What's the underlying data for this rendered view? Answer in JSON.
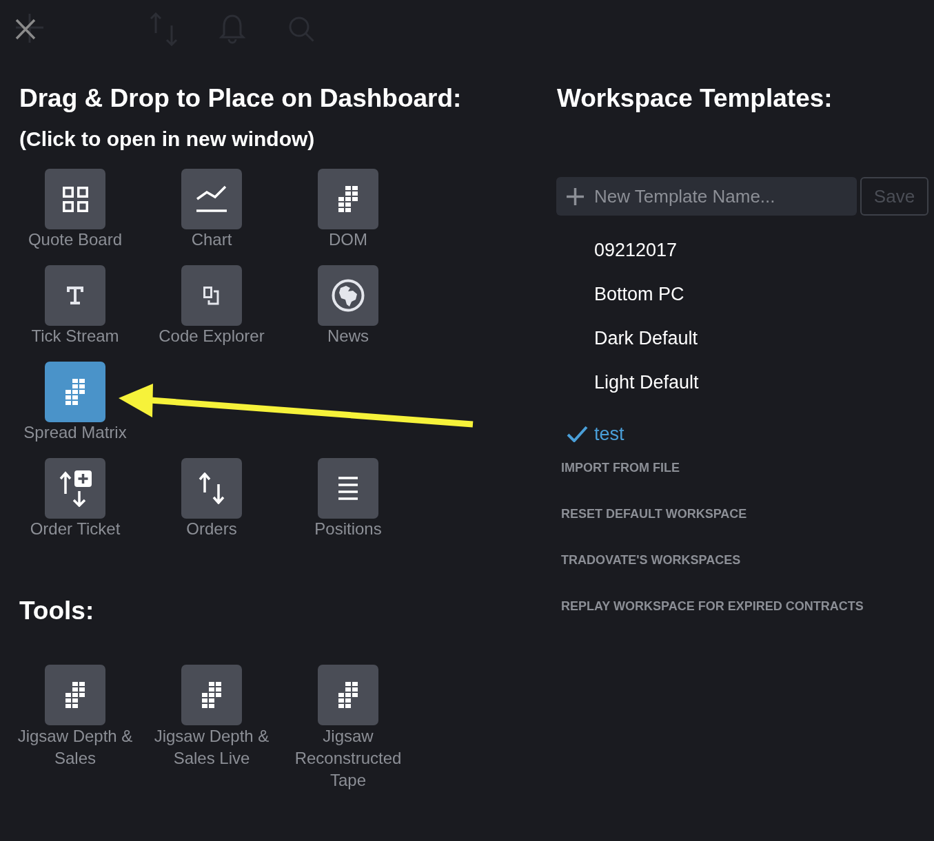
{
  "toolbar": {
    "buttons": [
      {
        "kind": "add",
        "disabled": true
      },
      {
        "kind": "close",
        "disabled": false
      },
      {
        "kind": "transfer",
        "disabled": true
      },
      {
        "kind": "notifications",
        "disabled": true
      },
      {
        "kind": "search",
        "disabled": true
      }
    ]
  },
  "widgets": {
    "title": "Drag & Drop to Place on Dashboard:",
    "subtitle": "(Click to open in new window)",
    "rows": [
      {
        "items": [
          {
            "label": "Quote Board",
            "kind": "quote_board",
            "selected": false
          },
          {
            "label": "Chart",
            "kind": "chart",
            "selected": false
          },
          {
            "label": "DOM",
            "kind": "depth",
            "selected": false
          }
        ]
      },
      {
        "items": [
          {
            "label": "Tick Stream",
            "kind": "tick_stream",
            "selected": false
          },
          {
            "label": "Code Explorer",
            "kind": "code_explorer",
            "selected": false
          },
          {
            "label": "News",
            "kind": "news",
            "selected": false
          }
        ]
      },
      {
        "items": [
          {
            "label": "Spread Matrix",
            "kind": "depth",
            "selected": true
          }
        ]
      },
      {
        "items": [
          {
            "label": "Order Ticket",
            "kind": "order_ticket",
            "selected": false
          },
          {
            "label": "Orders",
            "kind": "orders",
            "selected": false
          },
          {
            "label": "Positions",
            "kind": "positions",
            "selected": false
          }
        ]
      }
    ]
  },
  "annotations": [
    {
      "kind": "arrow"
    }
  ],
  "tools": {
    "title": "Tools:",
    "items": [
      {
        "label": "Jigsaw Depth & Sales",
        "kind": "depth",
        "selected": false
      },
      {
        "label": "Jigsaw Depth & Sales Live",
        "kind": "depth",
        "selected": false
      },
      {
        "label": "Jigsaw Reconstructed Tape",
        "kind": "depth",
        "selected": false
      }
    ]
  },
  "workspace_templates": {
    "title": "Workspace Templates:",
    "new_template": {
      "placeholder": "New Template Name..."
    },
    "save_button": {
      "label": "Save",
      "disabled": true
    },
    "templates": [
      {
        "name": "09212017",
        "selected": false
      },
      {
        "name": "Bottom PC",
        "selected": false
      },
      {
        "name": "Dark Default",
        "selected": false
      },
      {
        "name": "Light Default",
        "selected": false
      },
      {
        "name": "test",
        "selected": true
      }
    ],
    "actions": [
      "IMPORT FROM FILE",
      "RESET DEFAULT WORKSPACE",
      "TRADOVATE'S WORKSPACES",
      "REPLAY WORKSPACE FOR EXPIRED CONTRACTS"
    ]
  }
}
